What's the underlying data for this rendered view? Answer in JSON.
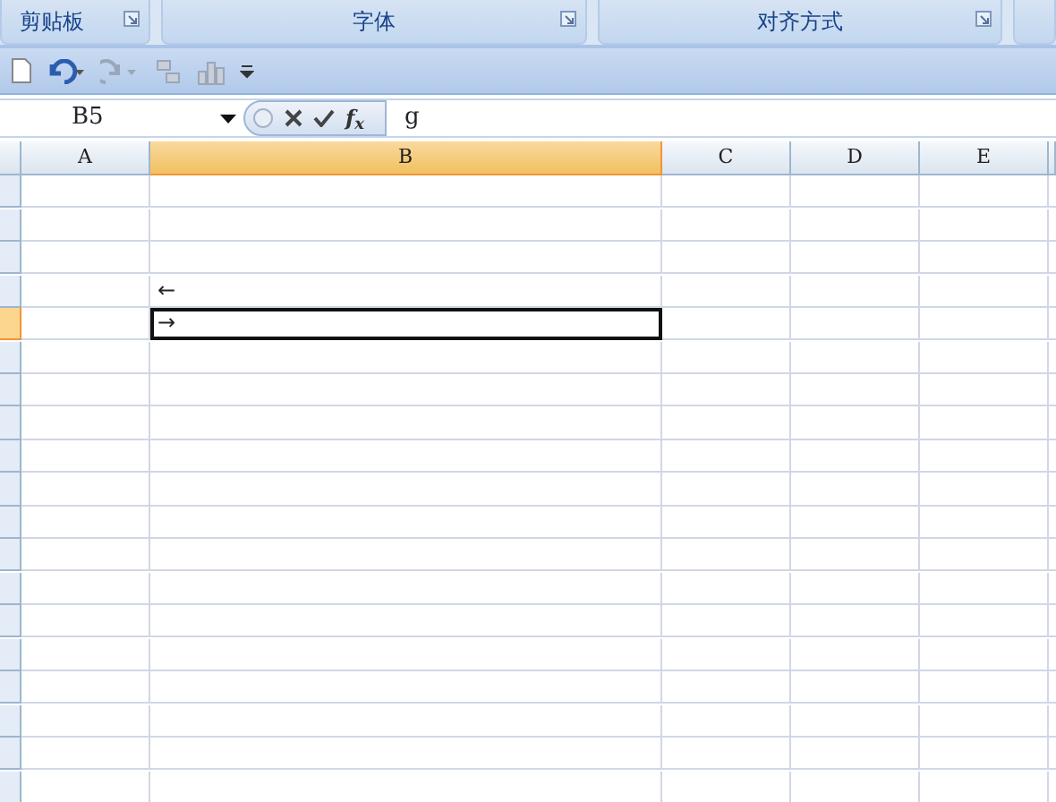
{
  "ribbon_groups": [
    {
      "label": "剪贴板"
    },
    {
      "label": "字体"
    },
    {
      "label": "对齐方式"
    }
  ],
  "formula_bar": {
    "name_box": "B5",
    "function_label": "f$_{x}$",
    "value": "g"
  },
  "sheet": {
    "columns": [
      {
        "label": "A",
        "selected": false
      },
      {
        "label": "B",
        "selected": true
      },
      {
        "label": "C",
        "selected": false
      },
      {
        "label": "D",
        "selected": false
      },
      {
        "label": "E",
        "selected": false
      }
    ],
    "rows": [
      {
        "selected": false
      },
      {
        "selected": false
      },
      {
        "selected": false
      },
      {
        "selected": false,
        "cell_b": "←"
      },
      {
        "selected": true,
        "cell_b": "→"
      },
      {
        "selected": false
      },
      {
        "selected": false
      },
      {
        "selected": false
      },
      {
        "selected": false
      },
      {
        "selected": false
      },
      {
        "selected": false
      },
      {
        "selected": false
      },
      {
        "selected": false
      },
      {
        "selected": false
      },
      {
        "selected": false
      },
      {
        "selected": false
      },
      {
        "selected": false
      },
      {
        "selected": false
      },
      {
        "selected": false
      }
    ]
  }
}
